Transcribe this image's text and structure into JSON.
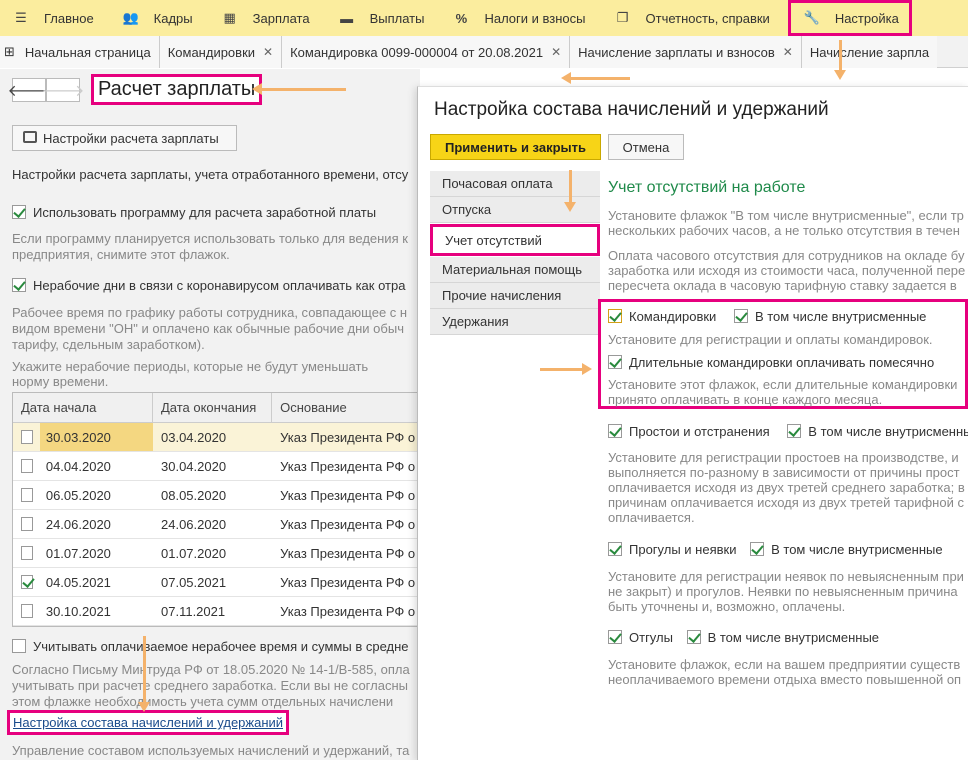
{
  "topmenu": [
    {
      "icon": "menu-icon",
      "label": "Главное"
    },
    {
      "icon": "people-icon",
      "label": "Кадры"
    },
    {
      "icon": "calculator-icon",
      "label": "Зарплата"
    },
    {
      "icon": "wallet-icon",
      "label": "Выплаты"
    },
    {
      "icon": "percent-icon",
      "label": "Налоги и взносы"
    },
    {
      "icon": "report-icon",
      "label": "Отчетность, справки"
    },
    {
      "icon": "wrench-icon",
      "label": "Настройка"
    }
  ],
  "tabs": [
    {
      "label": "Начальная страница",
      "closable": false
    },
    {
      "label": "Командировки",
      "closable": true
    },
    {
      "label": "Командировка 0099-000004 от 20.08.2021",
      "closable": true
    },
    {
      "label": "Начисление зарплаты и взносов",
      "closable": true
    },
    {
      "label": "Начисление зарпла",
      "closable": false
    }
  ],
  "left": {
    "title": "Расчет зарплаты",
    "settings_button": "Настройки расчета зарплаты",
    "intro": "Настройки расчета зарплаты, учета отработанного времени, отсу",
    "use_program_label": "Использовать программу для расчета заработной платы",
    "use_program_hint1": "Если программу планируется использовать только для ведения к",
    "use_program_hint2": "предприятия, снимите этот флажок.",
    "covid_label": "Нерабочие дни в связи с коронавирусом оплачивать как отра",
    "covid_hint1": "Рабочее время по графику работы сотрудника, совпадающее с н",
    "covid_hint2": "видом времени \"ОН\" и оплачено как обычные рабочие дни обыч",
    "covid_hint3": "тарифу, сдельным заработком).",
    "periods_hint1": "Укажите нерабочие периоды, которые не будут уменьшать",
    "periods_hint2": "норму времени.",
    "table": {
      "columns": [
        "Дата начала",
        "Дата окончания",
        "Основание"
      ],
      "rows": [
        {
          "checked": false,
          "start": "30.03.2020",
          "end": "03.04.2020",
          "basis": "Указ Президента РФ о"
        },
        {
          "checked": false,
          "start": "04.04.2020",
          "end": "30.04.2020",
          "basis": "Указ Президента РФ о"
        },
        {
          "checked": false,
          "start": "06.05.2020",
          "end": "08.05.2020",
          "basis": "Указ Президента РФ о"
        },
        {
          "checked": false,
          "start": "24.06.2020",
          "end": "24.06.2020",
          "basis": "Указ Президента РФ о"
        },
        {
          "checked": false,
          "start": "01.07.2020",
          "end": "01.07.2020",
          "basis": "Указ Президента РФ о"
        },
        {
          "checked": true,
          "start": "04.05.2021",
          "end": "07.05.2021",
          "basis": "Указ Президента РФ о"
        },
        {
          "checked": false,
          "start": "30.10.2021",
          "end": "07.11.2021",
          "basis": "Указ Президента РФ о"
        }
      ]
    },
    "avg_label": "Учитывать оплачиваемое нерабочее время и суммы в средне",
    "avg_hint1": "Согласно Письму Минтруда РФ от 18.05.2020 № 14-1/В-585, опла",
    "avg_hint2": "учитывать при расчете среднего заработка. Если вы не согласны",
    "avg_hint3": "этом флажке необходимость учета сумм отдельных начислени",
    "link": "Настройка состава начислений и удержаний",
    "link_hint": "Управление составом используемых начислений и удержаний, та"
  },
  "dialog": {
    "title": "Настройка состава начислений и удержаний",
    "apply": "Применить и закрыть",
    "cancel": "Отмена",
    "vtabs": [
      "Почасовая оплата",
      "Отпуска",
      "Учет отсутствий",
      "Материальная помощь",
      "Прочие начисления",
      "Удержания"
    ],
    "section_title": "Учет отсутствий на работе",
    "p1": [
      "Установите флажок \"В том числе внутрисменные\", если тр",
      "нескольких рабочих часов, а не только отсутствия в течен"
    ],
    "p2": [
      "Оплата часового отсутствия для сотрудников на окладе бу",
      "заработка или исходя из стоимости часа, полученной пере",
      "пересчета оклада в часовую тарифную ставку задается в"
    ],
    "trips_label": "Командировки",
    "trips_intra": "В том числе внутрисменные",
    "trips_hint": "Установите для регистрации и оплаты командировок.",
    "long_label": "Длительные командировки оплачивать помесячно",
    "long_hint": [
      "Установите этот флажок, если длительные командировки",
      "принято оплачивать в конце каждого месяца."
    ],
    "idle_label": "Простои и отстранения",
    "idle_intra": "В том числе внутрисменны",
    "idle_hint": [
      "Установите для регистрации простоев на производстве, и",
      "выполняется по-разному в зависимости от причины прост",
      "оплачивается исходя из двух третей среднего заработка; в",
      "причинам оплачивается исходя из двух третей тарифной с",
      "оплачивается."
    ],
    "absent_label": "Прогулы и неявки",
    "absent_intra": "В том числе внутрисменные",
    "absent_hint": [
      "Установите для регистрации неявок по невыясненным при",
      "не закрыт) и прогулов. Неявки по невыясненным причина",
      "быть уточнены и, возможно, оплачены."
    ],
    "off_label": "Отгулы",
    "off_intra": "В том числе внутрисменные",
    "off_hint": [
      "Установите флажок, если на вашем предприятии существ",
      "неоплачиваемого времени отдыха вместо повышенной оп"
    ]
  }
}
